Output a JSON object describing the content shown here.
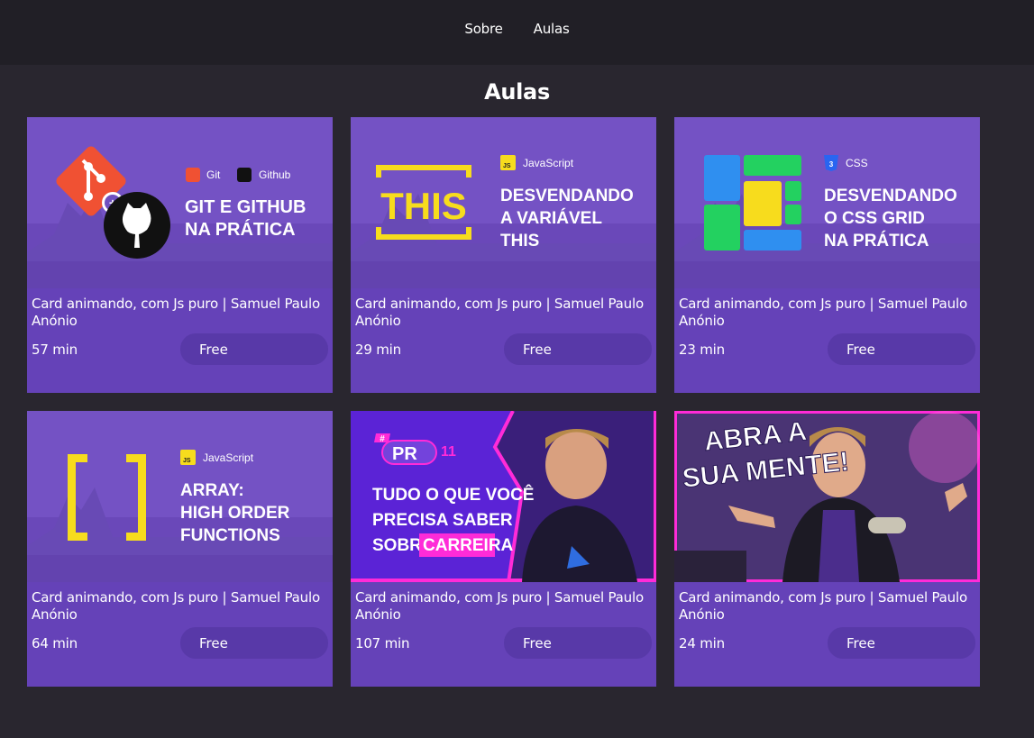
{
  "nav": {
    "items": [
      "Sobre",
      "Aulas"
    ]
  },
  "section": {
    "title": "Aulas"
  },
  "cards": [
    {
      "title": "Card animando, com Js puro | Samuel Paulo Anónio",
      "duration": "57 min",
      "price": "Free",
      "thumb": {
        "tags": [
          "Git",
          "Github"
        ],
        "lines": [
          "GIT E GITHUB",
          "NA PRÁTICA"
        ]
      }
    },
    {
      "title": "Card animando, com Js puro | Samuel Paulo Anónio",
      "duration": "29 min",
      "price": "Free",
      "thumb": {
        "tags": [
          "JavaScript"
        ],
        "big": "THIS",
        "lines": [
          "DESVENDANDO",
          "A VARIÁVEL",
          "THIS"
        ]
      }
    },
    {
      "title": "Card animando, com Js puro | Samuel Paulo Anónio",
      "duration": "23 min",
      "price": "Free",
      "thumb": {
        "tags": [
          "CSS"
        ],
        "lines": [
          "DESVENDANDO",
          "O CSS GRID",
          "NA PRÁTICA"
        ]
      }
    },
    {
      "title": "Card animando, com Js puro | Samuel Paulo Anónio",
      "duration": "64 min",
      "price": "Free",
      "thumb": {
        "tags": [
          "JavaScript"
        ],
        "big": "[ ]",
        "lines": [
          "ARRAY:",
          "HIGH ORDER",
          "FUNCTIONS"
        ]
      }
    },
    {
      "title": "Card animando, com Js puro | Samuel Paulo Anónio",
      "duration": "107 min",
      "price": "Free",
      "thumb": {
        "hash": "#",
        "badge": "PR",
        "number": "11",
        "lines": [
          "TUDO O QUE VOCÊ",
          "PRECISA SABER",
          "SOBRE"
        ],
        "highlight": "CARREIRA"
      }
    },
    {
      "title": "Card animando, com Js puro | Samuel Paulo Anónio",
      "duration": "24 min",
      "price": "Free",
      "thumb": {
        "lines": [
          "ABRA A",
          "SUA MENTE!"
        ]
      }
    }
  ],
  "colors": {
    "page_bg": "#29262f",
    "header_bg": "#211f26",
    "card_bg": "#6542b8",
    "button_bg": "#5839a8",
    "accent_yellow": "#f7dc1d",
    "accent_pink": "#ff2bd8"
  },
  "icons": [
    "git-icon",
    "github-icon",
    "javascript-icon",
    "css3-icon"
  ]
}
